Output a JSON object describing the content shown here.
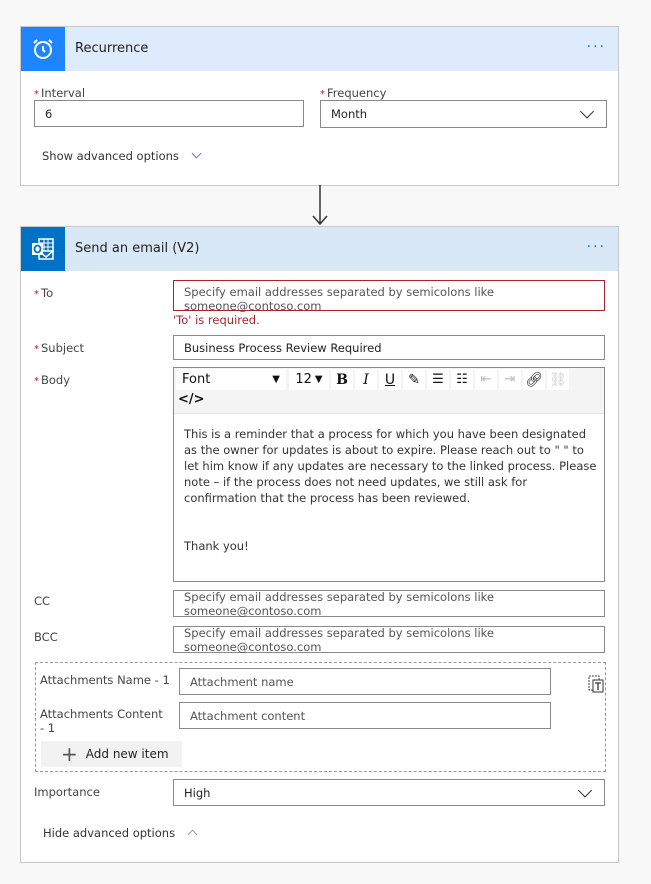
{
  "recurrence": {
    "title": "Recurrence",
    "icon": "alarm-clock-icon",
    "header_color": "#ddebfd",
    "icon_bg": "#1f85ff",
    "more": "···",
    "interval_label": "Interval",
    "interval_value": "6",
    "frequency_label": "Frequency",
    "frequency_value": "Month",
    "required_mark": "*",
    "advanced_link": "Show advanced options"
  },
  "email": {
    "title": "Send an email (V2)",
    "icon": "outlook-icon",
    "header_color": "#d8e8f7",
    "icon_bg": "#0072c6",
    "more": "···",
    "required_mark": "*",
    "to_label": "To",
    "to_placeholder": "Specify email addresses separated by semicolons like someone@contoso.com",
    "to_error": "'To' is required.",
    "subject_label": "Subject",
    "subject_value": "Business Process Review Required",
    "body_label": "Body",
    "toolbar": {
      "font": "Font",
      "size": "12",
      "bold": "B",
      "italic": "I",
      "underline": "U",
      "code": "</>"
    },
    "body_paragraph": "This is a reminder that a process for which you have been designated as the owner for updates is about to expire.  Please reach out to \" \" to let him know if any updates are necessary to the linked process.  Please note – if the process does not need updates, we still ask for confirmation that the process has been reviewed.",
    "body_closing": "Thank you!",
    "cc_label": "CC",
    "cc_placeholder": "Specify email addresses separated by semicolons like someone@contoso.com",
    "bcc_label": "BCC",
    "bcc_placeholder": "Specify email addresses separated by semicolons like someone@contoso.com",
    "attach_name_label": "Attachments Name - 1",
    "attach_name_placeholder": "Attachment name",
    "attach_content_label": "Attachments Content - 1",
    "attach_content_placeholder": "Attachment content",
    "add_item": "Add new item",
    "importance_label": "Importance",
    "importance_value": "High",
    "advanced_link": "Hide advanced options"
  }
}
